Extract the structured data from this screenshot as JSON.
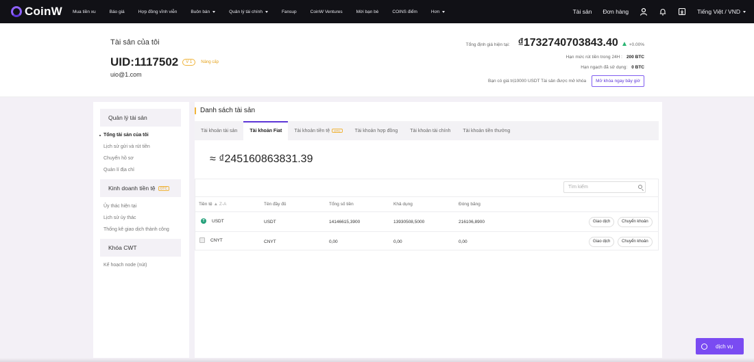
{
  "nav": {
    "logo": "CoinW",
    "items": [
      {
        "label": "Mua tiền xu",
        "dropdown": false
      },
      {
        "label": "Báo giá",
        "dropdown": false
      },
      {
        "label": "Hợp đồng vĩnh viễn",
        "dropdown": false
      },
      {
        "label": "Buôn bán",
        "dropdown": true
      },
      {
        "label": "Quản lý tài chính",
        "dropdown": true
      },
      {
        "label": "Fansup",
        "dropdown": false
      },
      {
        "label": "CoinW Ventures",
        "dropdown": false
      },
      {
        "label": "Mời bạn bè",
        "dropdown": false
      },
      {
        "label": "COINS điểm",
        "dropdown": false
      },
      {
        "label": "Hơn",
        "dropdown": true
      }
    ],
    "assets": "Tài sản",
    "orders": "Đơn hàng",
    "language": "Tiếng Việt / VND"
  },
  "header": {
    "title": "Tài sản của tôi",
    "uid": "UID:1117502",
    "vip": "V 1",
    "upgrade": "Nâng cấp",
    "email": "uio@1.com",
    "total_label": "Tổng định giá hiện tại:",
    "total_value": "₫1732740703843.40",
    "change_pct": "+0.00%",
    "withdraw_limit_label": "Hạn mức rút tiền trong 24H :",
    "withdraw_limit_value": "200 BTC",
    "used_label": "Hạn ngạch đã sử dụng:",
    "used_value": "0 BTC",
    "unlock_text": "Bạn có giá trị10000 USDT Tài sản được mở khóa",
    "unlock_button": "Mở khóa ngay bây giờ"
  },
  "sidebar": {
    "section1": "Quản lý tài sản",
    "items1": [
      "Tổng tài sản của tôi",
      "Lịch sử gửi và rút tiền",
      "Chuyển hồ sơ",
      "Quản lí địa chỉ"
    ],
    "section2": "Kinh doanh tiền tệ",
    "section2_badge": "OTC",
    "items2": [
      "Ủy thác hiện tại",
      "Lịch sử ủy thác",
      "Thống kê giao dịch thành công"
    ],
    "section3": "Khóa CWT",
    "items3": [
      "Kế hoạch node (nút)"
    ]
  },
  "main": {
    "title": "Danh sách tài sản",
    "tabs": [
      {
        "label": "Tài khoản tài sản",
        "badge": ""
      },
      {
        "label": "Tài khoản Fiat",
        "badge": ""
      },
      {
        "label": "Tài khoản tiền tệ",
        "badge": "OTC"
      },
      {
        "label": "Tài khoản hợp đồng",
        "badge": ""
      },
      {
        "label": "Tài khoản tài chính",
        "badge": ""
      },
      {
        "label": "Tài khoản tiền thưởng",
        "badge": ""
      }
    ],
    "active_tab": 1,
    "fiat_total": "≈ ₫245160863831.39",
    "search_placeholder": "Tìm kiếm",
    "columns": {
      "coin": "Tiền tệ",
      "sort": "▲ Z-A",
      "fullname": "Tên đầy đủ",
      "total": "Tổng số tiền",
      "available": "Khả dụng",
      "frozen": "Đóng băng"
    },
    "rows": [
      {
        "coin": "USDT",
        "icon": "tether-icon",
        "fullname": "USDT",
        "total": "14146615,3900",
        "available": "13930508,5000",
        "frozen": "216106,8900",
        "trade": "Giao dịch",
        "transfer": "Chuyển khoản"
      },
      {
        "coin": "CNYT",
        "icon": "broken-image-icon",
        "fullname": "CNYT",
        "total": "0,00",
        "available": "0,00",
        "frozen": "0,00",
        "trade": "Giao dịch",
        "transfer": "Chuyển khoản"
      }
    ]
  },
  "chat": {
    "label": "dịch vụ"
  }
}
